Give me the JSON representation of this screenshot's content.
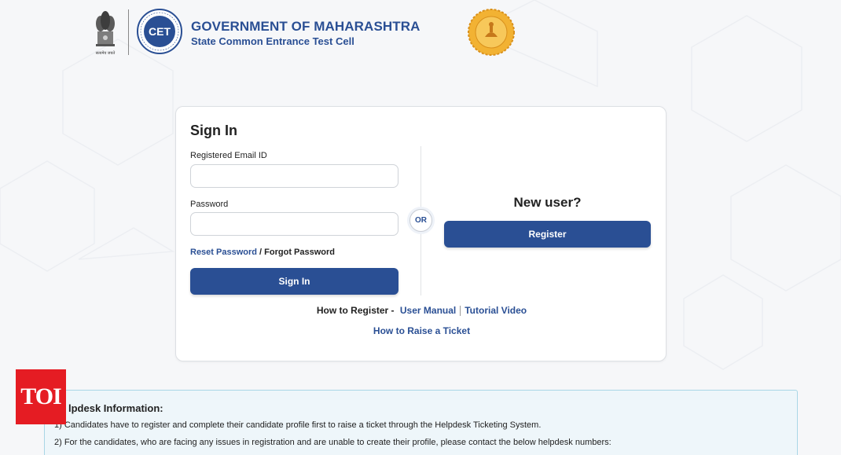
{
  "header": {
    "emblem_caption": "सत्यमेव जयते",
    "title": "GOVERNMENT OF MAHARASHTRA",
    "subtitle": "State Common Entrance Test Cell",
    "cet_logo_text": "CET"
  },
  "signin": {
    "title": "Sign In",
    "email_label": "Registered Email ID",
    "email_value": "",
    "password_label": "Password",
    "password_value": "",
    "reset_password": "Reset Password",
    "slash": " / ",
    "forgot_password": "Forgot Password",
    "signin_button": "Sign In"
  },
  "or_label": "OR",
  "newuser": {
    "title": "New user?",
    "register_button": "Register"
  },
  "help_links": {
    "how_to_register": "How to Register -",
    "user_manual": "User Manual",
    "tutorial_video": "Tutorial Video",
    "raise_ticket": "How to Raise a Ticket"
  },
  "helpdesk": {
    "title": "lpdesk Information:",
    "items": [
      "1)  Candidates have to register and complete their candidate profile first to raise a ticket through the Helpdesk Ticketing System.",
      "2)  For the candidates, who are facing any issues in registration and are unable to create their profile, please contact the below helpdesk numbers:"
    ]
  },
  "watermark": "TOI",
  "colors": {
    "brand_blue": "#2a4f94",
    "toi_red": "#e51c23",
    "helpdesk_bg": "#eef6fa",
    "seal_gold": "#e9a92a"
  },
  "icons": [
    "national-emblem-icon",
    "cet-logo-icon",
    "maharashtra-seal-icon"
  ]
}
